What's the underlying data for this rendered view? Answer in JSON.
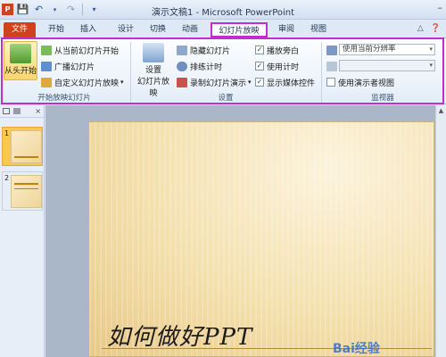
{
  "window": {
    "title": "演示文稿1 - Microsoft PowerPoint"
  },
  "qat": {
    "save_icon": "save-icon",
    "undo_icon": "undo-icon",
    "redo_icon": "redo-icon"
  },
  "tabs": [
    {
      "label": "文件"
    },
    {
      "label": "开始"
    },
    {
      "label": "插入"
    },
    {
      "label": "设计"
    },
    {
      "label": "切换"
    },
    {
      "label": "动画"
    },
    {
      "label": "幻灯片放映"
    },
    {
      "label": "审阅"
    },
    {
      "label": "视图"
    }
  ],
  "ribbon": {
    "start_group": {
      "label": "开始放映幻灯片",
      "from_start": "从头开始",
      "from_current": "从当前幻灯片开始",
      "broadcast": "广播幻灯片",
      "custom_show": "自定义幻灯片放映"
    },
    "setup_group": {
      "label": "设置",
      "setup_show": "设置",
      "setup_show_line2": "幻灯片放映",
      "hide_slide": "隐藏幻灯片",
      "rehearse": "排练计时",
      "record": "录制幻灯片演示",
      "play_narrations": "播放旁白",
      "use_timings": "使用计时",
      "show_media": "显示媒体控件"
    },
    "monitors_group": {
      "label": "监视器",
      "resolution": "使用当前分辨率",
      "show_on": "",
      "presenter_view": "使用演示者视图"
    }
  },
  "slides": [
    {
      "num": "1"
    },
    {
      "num": "2"
    }
  ],
  "slide": {
    "title": "如何做好PPT"
  },
  "watermark": "Bai经验",
  "colors": {
    "file_tab": "#d0421b",
    "highlight": "#c02ed2",
    "selected_button": "#fbd56e"
  }
}
